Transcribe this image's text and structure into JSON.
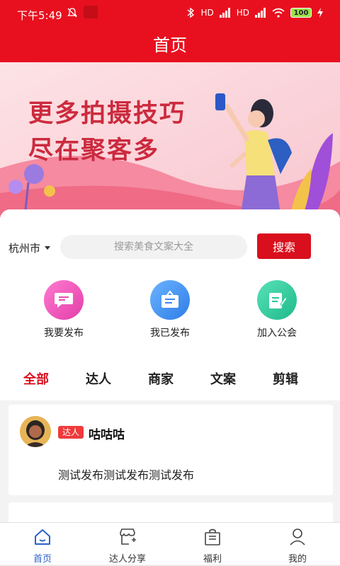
{
  "status_bar": {
    "time": "下午5:49",
    "signal1": "HD",
    "signal2": "HD",
    "battery": "100"
  },
  "header": {
    "title": "首页"
  },
  "banner": {
    "line1": "更多拍摄技巧",
    "line2": "尽在聚客多"
  },
  "search": {
    "city": "杭州市",
    "placeholder": "搜索美食文案大全",
    "value": "",
    "button_label": "搜索"
  },
  "quick_actions": [
    {
      "label": "我要发布",
      "icon": "chat-bubble-icon",
      "color": "#e94db3"
    },
    {
      "label": "我已发布",
      "icon": "board-icon",
      "color": "#3d8af0"
    },
    {
      "label": "加入公会",
      "icon": "edit-note-icon",
      "color": "#2cc898"
    }
  ],
  "tabs": [
    {
      "label": "全部",
      "active": true
    },
    {
      "label": "达人",
      "active": false
    },
    {
      "label": "商家",
      "active": false
    },
    {
      "label": "文案",
      "active": false
    },
    {
      "label": "剪辑",
      "active": false
    }
  ],
  "post": {
    "badge": "达人",
    "username": "咕咕咕",
    "text": "测试发布测试发布测试发布"
  },
  "bottom_nav": [
    {
      "label": "首页",
      "icon": "home-icon",
      "active": true
    },
    {
      "label": "达人分享",
      "icon": "shop-share-icon",
      "active": false
    },
    {
      "label": "福利",
      "icon": "gift-bag-icon",
      "active": false
    },
    {
      "label": "我的",
      "icon": "user-icon",
      "active": false
    }
  ],
  "colors": {
    "brand_red": "#e8101f",
    "active_tab": "#d90f1d",
    "nav_active": "#2b63c9"
  }
}
